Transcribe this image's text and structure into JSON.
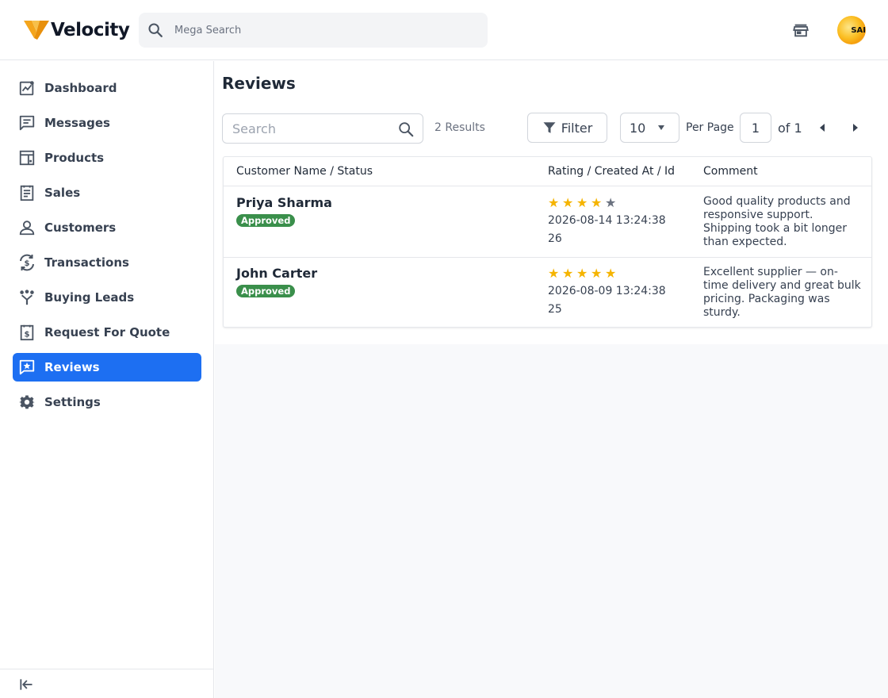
{
  "header": {
    "logo_text": "Velocity",
    "search_placeholder": "Mega Search",
    "avatar_text": "SAI"
  },
  "sidebar": {
    "items": [
      {
        "label": "Dashboard",
        "icon": "dashboard-icon"
      },
      {
        "label": "Messages",
        "icon": "messages-icon"
      },
      {
        "label": "Products",
        "icon": "products-icon"
      },
      {
        "label": "Sales",
        "icon": "sales-icon"
      },
      {
        "label": "Customers",
        "icon": "customers-icon"
      },
      {
        "label": "Transactions",
        "icon": "transactions-icon"
      },
      {
        "label": "Buying Leads",
        "icon": "buying-leads-icon"
      },
      {
        "label": "Request For Quote",
        "icon": "rfq-icon"
      },
      {
        "label": "Reviews",
        "icon": "reviews-icon",
        "active": true
      },
      {
        "label": "Settings",
        "icon": "gear-icon"
      }
    ],
    "active_color": "#1d6ff2"
  },
  "main": {
    "title": "Reviews",
    "search_placeholder": "Search",
    "results_text": "2 Results",
    "filter_label": "Filter",
    "per_page_value": "10",
    "per_page_label": "Per Page",
    "current_page": "1",
    "of_pages": "of 1",
    "columns": [
      "Customer Name / Status",
      "Rating / Created At / Id",
      "Comment"
    ],
    "rows": [
      {
        "name": "Priya Sharma",
        "status": "Approved",
        "rating": 4,
        "created_at": "2026-08-14 13:24:38",
        "id": "26",
        "comment": "Good quality products and responsive support. Shipping took a bit longer than expected."
      },
      {
        "name": "John Carter",
        "status": "Approved",
        "rating": 5,
        "created_at": "2026-08-09 13:24:38",
        "id": "25",
        "comment": "Excellent supplier — on-time delivery and great bulk pricing. Packaging was sturdy."
      }
    ],
    "status_color": "#3a8f4b",
    "star_color": "#f5b400"
  }
}
